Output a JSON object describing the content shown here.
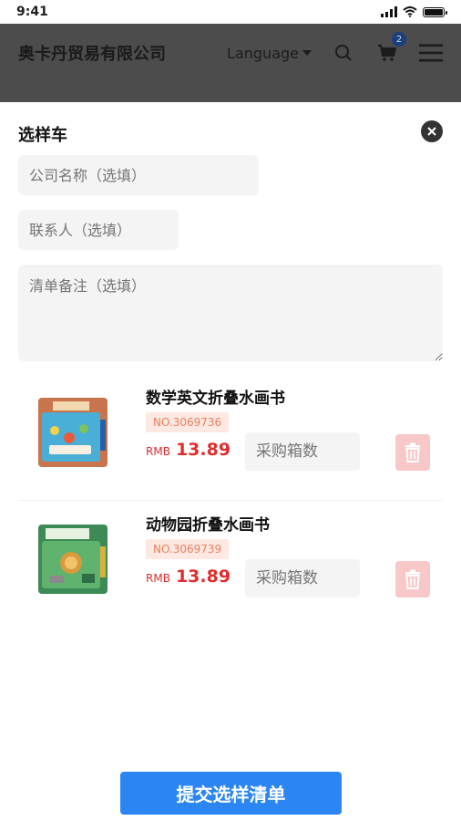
{
  "status_bar": {
    "time": "9:41"
  },
  "header": {
    "brand": "奥卡丹贸易有限公司",
    "language_label": "Language",
    "cart_count": "2"
  },
  "panel": {
    "title": "选样车",
    "fields": {
      "company_placeholder": "公司名称（选填）",
      "contact_placeholder": "联系人（选填）",
      "note_placeholder": "清单备注（选填）"
    },
    "items": [
      {
        "name": "数学英文折叠水画书",
        "sku": "NO.3069736",
        "currency": "RMB",
        "price": "13.89",
        "qty_placeholder": "采购箱数"
      },
      {
        "name": "动物园折叠水画书",
        "sku": "NO.3069739",
        "currency": "RMB",
        "price": "13.89",
        "qty_placeholder": "采购箱数"
      }
    ],
    "submit_label": "提交选样清单"
  },
  "colors": {
    "header_bg": "#4c4c4c",
    "accent_blue": "#2b86f3",
    "price_red": "#e02d2d",
    "sku_bg": "#fde8e2",
    "delete_bg": "#f8c7c7"
  }
}
